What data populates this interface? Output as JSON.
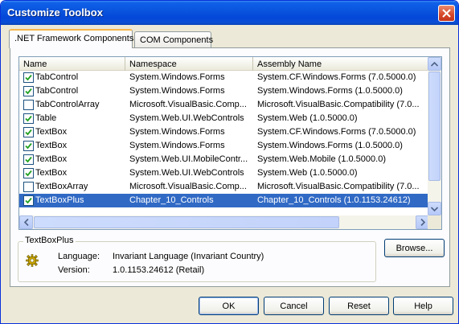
{
  "window": {
    "title": "Customize Toolbox"
  },
  "tabs": [
    {
      "label": ".NET Framework Components",
      "active": true
    },
    {
      "label": "COM Components",
      "active": false
    }
  ],
  "list": {
    "columns": [
      "Name",
      "Namespace",
      "Assembly Name"
    ],
    "rows": [
      {
        "checked": true,
        "name": "TabControl",
        "namespace": "System.Windows.Forms",
        "assembly": "System.CF.Windows.Forms (7.0.5000.0)"
      },
      {
        "checked": true,
        "name": "TabControl",
        "namespace": "System.Windows.Forms",
        "assembly": "System.Windows.Forms (1.0.5000.0)"
      },
      {
        "checked": false,
        "name": "TabControlArray",
        "namespace": "Microsoft.VisualBasic.Comp...",
        "assembly": "Microsoft.VisualBasic.Compatibility (7.0..."
      },
      {
        "checked": true,
        "name": "Table",
        "namespace": "System.Web.UI.WebControls",
        "assembly": "System.Web (1.0.5000.0)"
      },
      {
        "checked": true,
        "name": "TextBox",
        "namespace": "System.Windows.Forms",
        "assembly": "System.CF.Windows.Forms (7.0.5000.0)"
      },
      {
        "checked": true,
        "name": "TextBox",
        "namespace": "System.Windows.Forms",
        "assembly": "System.Windows.Forms (1.0.5000.0)"
      },
      {
        "checked": true,
        "name": "TextBox",
        "namespace": "System.Web.UI.MobileContr...",
        "assembly": "System.Web.Mobile (1.0.5000.0)"
      },
      {
        "checked": true,
        "name": "TextBox",
        "namespace": "System.Web.UI.WebControls",
        "assembly": "System.Web (1.0.5000.0)"
      },
      {
        "checked": false,
        "name": "TextBoxArray",
        "namespace": "Microsoft.VisualBasic.Comp...",
        "assembly": "Microsoft.VisualBasic.Compatibility (7.0..."
      },
      {
        "checked": true,
        "name": "TextBoxPlus",
        "namespace": "Chapter_10_Controls",
        "assembly": "Chapter_10_Controls (1.0.1153.24612)",
        "selected": true
      }
    ]
  },
  "details": {
    "group_title": "TextBoxPlus",
    "language_label": "Language:",
    "language_value": "Invariant Language (Invariant Country)",
    "version_label": "Version:",
    "version_value": "1.0.1153.24612 (Retail)",
    "icon": "gear-icon"
  },
  "buttons": {
    "browse": "Browse...",
    "ok": "OK",
    "cancel": "Cancel",
    "reset": "Reset",
    "help": "Help"
  },
  "colors": {
    "title_bar": "#0a55de",
    "selection": "#316ac5",
    "dialog_bg": "#ece9d8"
  }
}
